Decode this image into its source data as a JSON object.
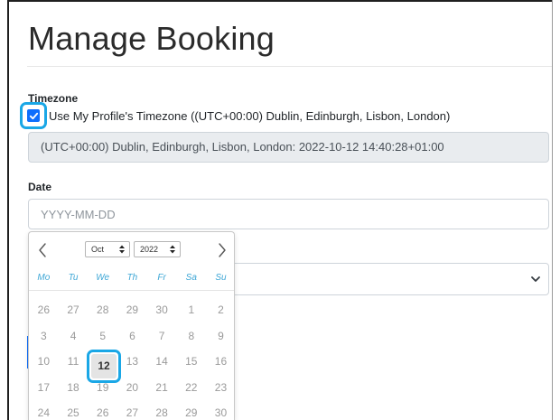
{
  "page": {
    "title": "Manage Booking"
  },
  "timezone": {
    "label": "Timezone",
    "use_profile_checked": true,
    "use_profile_label": "Use My Profile's Timezone ((UTC+00:00) Dublin, Edinburgh, Lisbon, London)",
    "current_value": "(UTC+00:00) Dublin, Edinburgh, Lisbon, London: 2022-10-12 14:40:28+01:00"
  },
  "date": {
    "label": "Date",
    "placeholder": "YYYY-MM-DD",
    "value": ""
  },
  "datepicker": {
    "month": "Oct",
    "year": "2022",
    "weekdays": [
      "Mo",
      "Tu",
      "We",
      "Th",
      "Fr",
      "Sa",
      "Su"
    ],
    "weeks": [
      [
        "26",
        "27",
        "28",
        "29",
        "30",
        "1",
        "2"
      ],
      [
        "3",
        "4",
        "5",
        "6",
        "7",
        "8",
        "9"
      ],
      [
        "10",
        "11",
        "12",
        "13",
        "14",
        "15",
        "16"
      ],
      [
        "17",
        "18",
        "19",
        "20",
        "21",
        "22",
        "23"
      ],
      [
        "24",
        "25",
        "26",
        "27",
        "28",
        "29",
        "30"
      ]
    ],
    "selected_day": "12",
    "icons": {
      "prev": "chevron-left-icon",
      "next": "chevron-right-icon",
      "select_arrows": "up-down-arrows-icon"
    }
  },
  "select": {
    "value": "",
    "icon": "chevron-down-icon"
  },
  "colors": {
    "accent": "#0d6efd",
    "highlight": "#1aa7e6",
    "weekday": "#3fa7d6",
    "readonly_bg": "#e9ecef"
  }
}
